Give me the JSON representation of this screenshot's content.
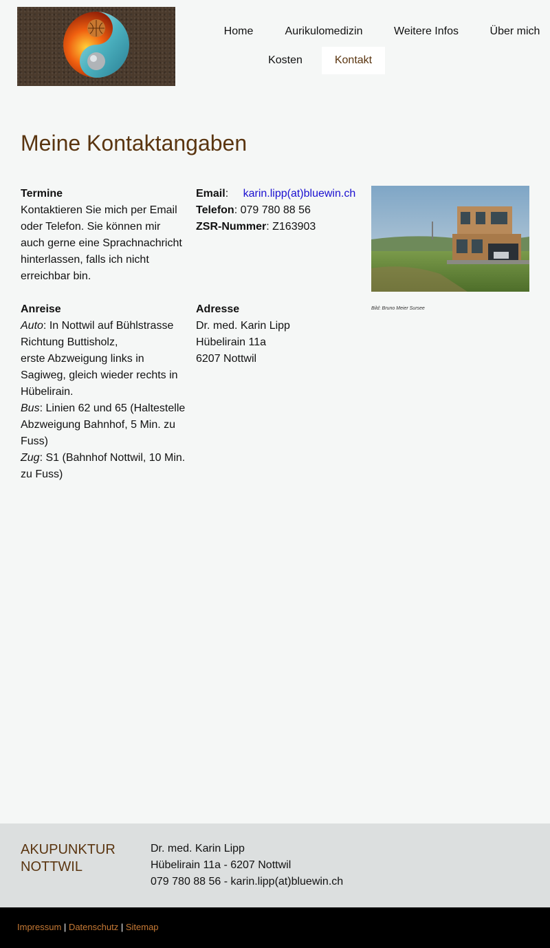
{
  "nav": {
    "items": [
      {
        "label": "Home"
      },
      {
        "label": "Aurikulomedizin"
      },
      {
        "label": "Weitere Infos"
      },
      {
        "label": "Über mich"
      },
      {
        "label": "Kosten"
      },
      {
        "label": "Kontakt",
        "active": true
      }
    ]
  },
  "page": {
    "title": "Meine Kontaktangaben"
  },
  "termine": {
    "heading": "Termine",
    "text": "Kontaktieren Sie mich per Email oder Telefon. Sie können mir auch gerne eine Sprachnachricht hinterlassen, falls ich nicht erreichbar bin."
  },
  "contact": {
    "email_label": "Email",
    "email_value": "karin.lipp(at)bluewin.ch",
    "phone_label": "Telefon",
    "phone_value": "079 780 88 56",
    "zsr_label": "ZSR-Nummer",
    "zsr_value": "Z163903"
  },
  "anreise": {
    "heading": "Anreise",
    "auto_label": "Auto",
    "auto_text": ": In Nottwil auf Bühlstrasse Richtung Buttisholz,",
    "auto_text2": "erste Abzweigung links in Sagiweg, gleich wieder rechts in Hübelirain.",
    "bus_label": "Bus",
    "bus_text": ": Linien 62 und 65 (Haltestelle Abzweigung Bahnhof, 5 Min. zu Fuss)",
    "zug_label": "Zug",
    "zug_text": ": S1 (Bahnhof Nottwil, 10 Min. zu Fuss)"
  },
  "adresse": {
    "heading": "Adresse",
    "line1": "Dr. med. Karin Lipp",
    "line2": "Hübelirain 11a",
    "line3": "6207 Nottwil"
  },
  "photo": {
    "caption": "Bild: Bruno Meier Sursee"
  },
  "footer": {
    "brand_line1": "AKUPUNKTUR",
    "brand_line2": "NOTTWIL",
    "addr_line1": "Dr. med. Karin Lipp",
    "addr_line2": "Hübelirain 11a - 6207 Nottwil",
    "addr_line3": "079 780 88 56 - karin.lipp(at)bluewin.ch"
  },
  "bottom": {
    "impressum": "Impressum",
    "datenschutz": "Datenschutz",
    "sitemap": "Sitemap",
    "separator": "|"
  },
  "colors": {
    "accent": "#5a3510",
    "link": "#1a0fd0",
    "footer_link": "#c77a35",
    "footer_bg": "#dcdfdf",
    "page_bg": "#f5f7f6"
  }
}
